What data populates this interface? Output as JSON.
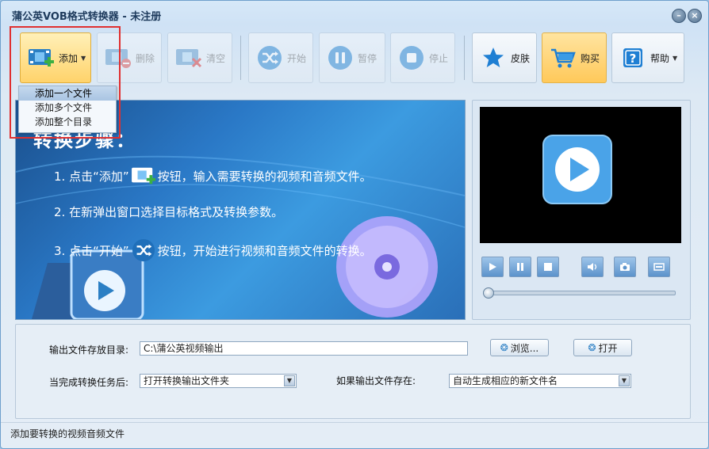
{
  "window": {
    "title": "蒲公英VOB格式转换器 - 未注册",
    "min_symbol": "–",
    "close_symbol": "×"
  },
  "toolbar": {
    "add": {
      "label": "添加",
      "icon": "film-add-icon",
      "state": "active"
    },
    "delete": {
      "label": "删除",
      "icon": "film-delete-icon",
      "state": "disabled"
    },
    "clear": {
      "label": "清空",
      "icon": "film-clear-icon",
      "state": "disabled"
    },
    "start": {
      "label": "开始",
      "icon": "shuffle-icon",
      "state": "disabled"
    },
    "pause": {
      "label": "暂停",
      "icon": "pause-icon",
      "state": "disabled"
    },
    "stop": {
      "label": "停止",
      "icon": "stop-icon",
      "state": "disabled"
    },
    "skin": {
      "label": "皮肤",
      "icon": "star-icon"
    },
    "buy": {
      "label": "购买",
      "icon": "cart-icon"
    },
    "help": {
      "label": "帮助",
      "icon": "help-icon"
    }
  },
  "add_menu": {
    "items": [
      "添加一个文件",
      "添加多个文件",
      "添加整个目录"
    ],
    "selected_index": 0
  },
  "banner": {
    "heading": "转换步骤：",
    "step1_a": "1. 点击“添加”",
    "step1_b": "按钮，输入需要转换的视频和音频文件。",
    "step2": "2. 在新弹出窗口选择目标格式及转换参数。",
    "step3_a": "3. 点击“开始”",
    "step3_b": "按钮，开始进行视频和音频文件的转换。"
  },
  "player": {
    "progress": 0,
    "controls": [
      "play-icon",
      "pause-icon",
      "stop-icon",
      "volume-icon",
      "snapshot-icon",
      "fullscreen-icon"
    ]
  },
  "settings": {
    "output_dir_label": "输出文件存放目录:",
    "output_dir_value": "C:\\蒲公英视频输出",
    "browse_label": "浏览...",
    "open_label": "打开",
    "after_done_label": "当完成转换任务后:",
    "after_done_value": "打开转换输出文件夹",
    "if_exists_label": "如果输出文件存在:",
    "if_exists_value": "自动生成相应的新文件名"
  },
  "status": {
    "text": "添加要转换的视频音频文件"
  },
  "colors": {
    "accent": "#ffc95a",
    "highlight_box": "#e03030",
    "banner": "#2a78c6"
  }
}
